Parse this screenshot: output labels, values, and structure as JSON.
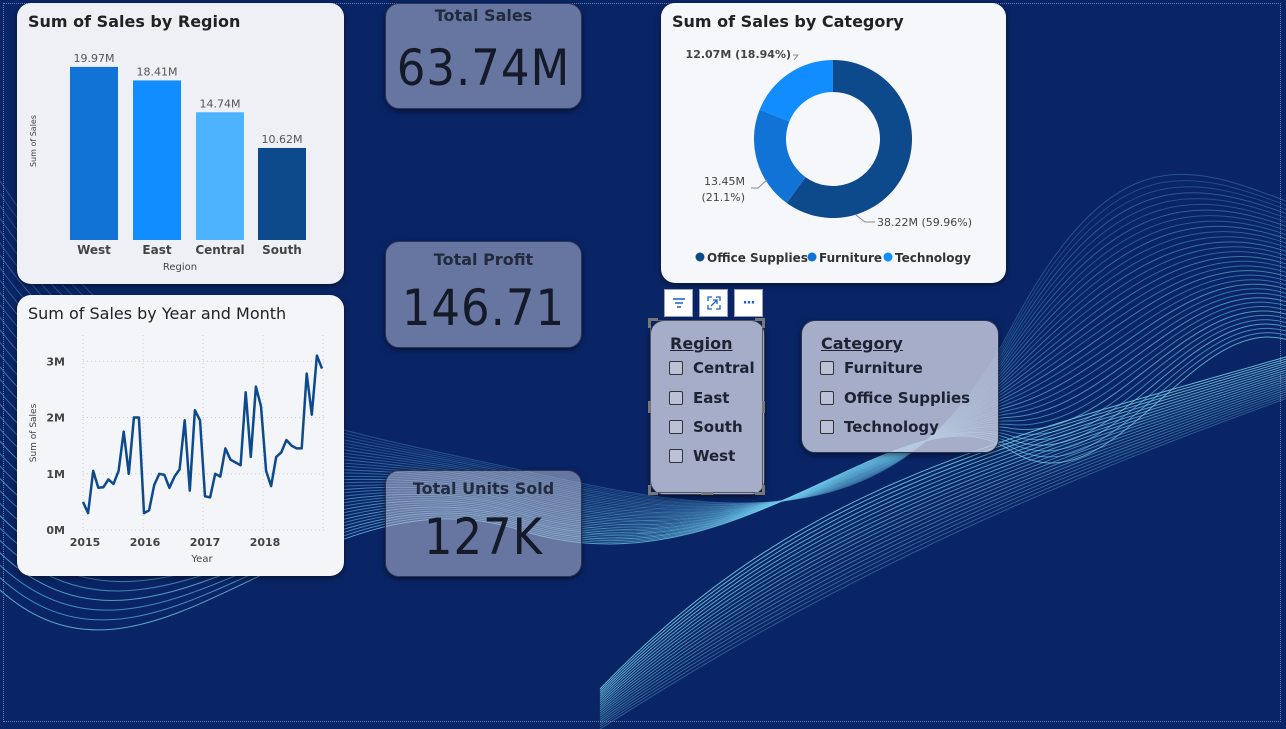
{
  "region_chart": {
    "title": "Sum of Sales by Region",
    "chart_data": {
      "type": "bar",
      "categories": [
        "West",
        "East",
        "Central",
        "South"
      ],
      "values": [
        19.97,
        18.41,
        14.74,
        10.62
      ],
      "data_labels": [
        "19.97M",
        "18.41M",
        "14.74M",
        "10.62M"
      ],
      "colors": [
        "#1173d6",
        "#118dff",
        "#4eb3ff",
        "#0c4a8c"
      ],
      "xlabel": "Region",
      "ylabel": "Sum of Sales",
      "unit": "M"
    }
  },
  "line_chart": {
    "title": "Sum of Sales by Year and Month",
    "chart_data": {
      "type": "line",
      "xlabel": "Year",
      "ylabel": "Sum of Sales",
      "x_ticks": [
        "2015",
        "2016",
        "2017",
        "2018"
      ],
      "y_ticks": [
        "0M",
        "1M",
        "2M",
        "3M"
      ],
      "ylim": [
        0,
        3.2
      ],
      "grid": true,
      "color": "#0c4a8c",
      "series": [
        {
          "values": [
            0.5,
            0.3,
            1.05,
            0.75,
            0.76,
            0.9,
            0.82,
            1.05,
            1.75,
            1.0,
            2.0,
            2.0,
            0.3,
            0.35,
            0.8,
            1.0,
            0.98,
            0.75,
            0.95,
            1.08,
            1.95,
            0.7,
            2.13,
            1.95,
            0.6,
            0.58,
            1.0,
            0.95,
            1.45,
            1.25,
            1.2,
            1.15,
            2.45,
            1.3,
            2.55,
            2.2,
            1.05,
            0.78,
            1.3,
            1.38,
            1.6,
            1.5,
            1.45,
            1.45,
            2.78,
            2.05,
            3.1,
            2.87
          ]
        }
      ]
    }
  },
  "kpis": [
    {
      "title": "Total Sales",
      "value": "63.74M"
    },
    {
      "title": "Total Profit",
      "value": "146.71"
    },
    {
      "title": "Total Units Sold",
      "value": "127K"
    }
  ],
  "category_chart": {
    "title": "Sum of Sales by Category",
    "chart_data": {
      "type": "pie",
      "slices": [
        {
          "name": "Office Supplies",
          "value": 38.22,
          "label": "38.22M (59.96%)",
          "color": "#0c4a8c"
        },
        {
          "name": "Furniture",
          "value": 13.45,
          "label_line1": "13.45M",
          "label_line2": "(21.1%)",
          "color": "#1173d6"
        },
        {
          "name": "Technology",
          "value": 12.07,
          "label": "12.07M (18.94%)",
          "color": "#118dff"
        }
      ],
      "legend": [
        "Office Supplies",
        "Furniture",
        "Technology"
      ]
    }
  },
  "visual_toolbar": {
    "icons": [
      "filter-icon",
      "focus-mode-icon",
      "more-options-icon"
    ],
    "more_glyph": "···"
  },
  "region_slicer": {
    "title": "Region",
    "options": [
      "Central",
      "East",
      "South",
      "West"
    ]
  },
  "category_slicer": {
    "title": "Category",
    "options": [
      "Furniture",
      "Office Supplies",
      "Technology"
    ]
  }
}
